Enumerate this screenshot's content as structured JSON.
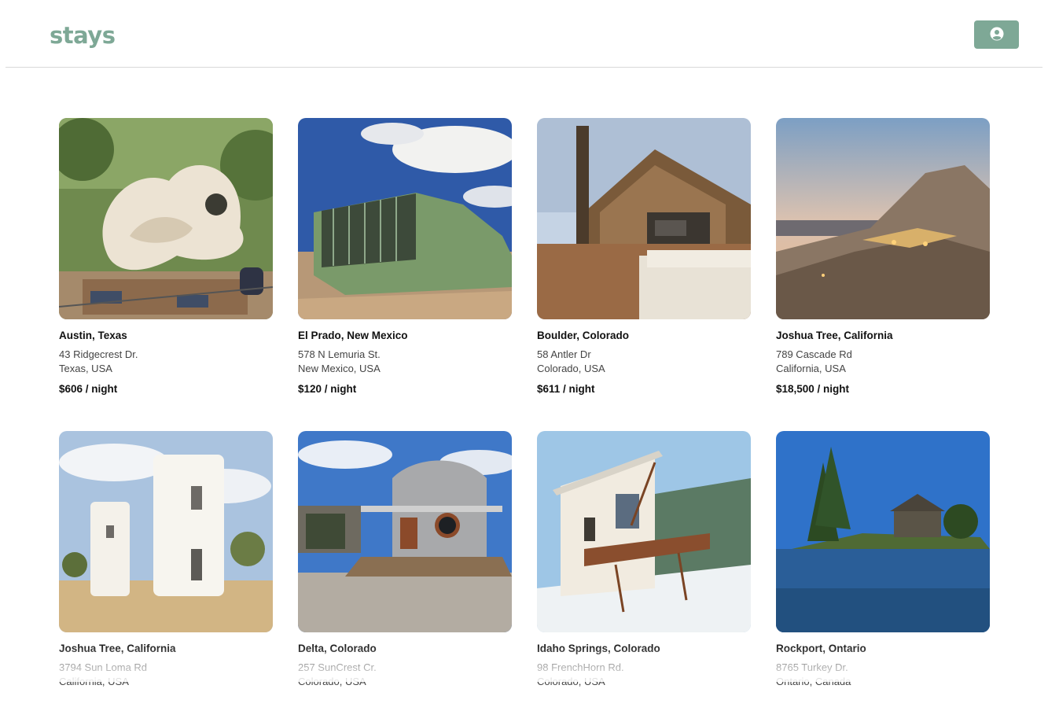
{
  "header": {
    "logo": "stays",
    "account_icon": "user-circle-icon",
    "accent_color": "#7ea896"
  },
  "listings": [
    {
      "city": "Austin, Texas",
      "street": "43 Ridgecrest Dr.",
      "region": "Texas, USA",
      "price": "$606 / night",
      "photo": "white-sculpted-house"
    },
    {
      "city": "El Prado, New Mexico",
      "street": "578 N Lemuria St.",
      "region": "New Mexico, USA",
      "price": "$120 / night",
      "photo": "green-earthship"
    },
    {
      "city": "Boulder, Colorado",
      "street": "58 Antler Dr",
      "region": "Colorado, USA",
      "price": "$611 / night",
      "photo": "wood-deck-house"
    },
    {
      "city": "Joshua Tree, California",
      "street": "789 Cascade Rd",
      "region": "California, USA",
      "price": "$18,500 / night",
      "photo": "desert-rock-house"
    },
    {
      "city": "Joshua Tree, California",
      "street": "3794 Sun Loma Rd",
      "region": "California, USA",
      "price": "",
      "photo": "white-tower-houses"
    },
    {
      "city": "Delta, Colorado",
      "street": "257 SunCrest Cr.",
      "region": "Colorado, USA",
      "price": "",
      "photo": "grain-bin-house"
    },
    {
      "city": "Idaho Springs, Colorado",
      "street": "98 FrenchHorn Rd.",
      "region": "Colorado, USA",
      "price": "",
      "photo": "snowy-cabin"
    },
    {
      "city": "Rockport, Ontario",
      "street": "8765 Turkey Dr.",
      "region": "Ontario, Canada",
      "price": "",
      "photo": "lake-island-house"
    }
  ]
}
